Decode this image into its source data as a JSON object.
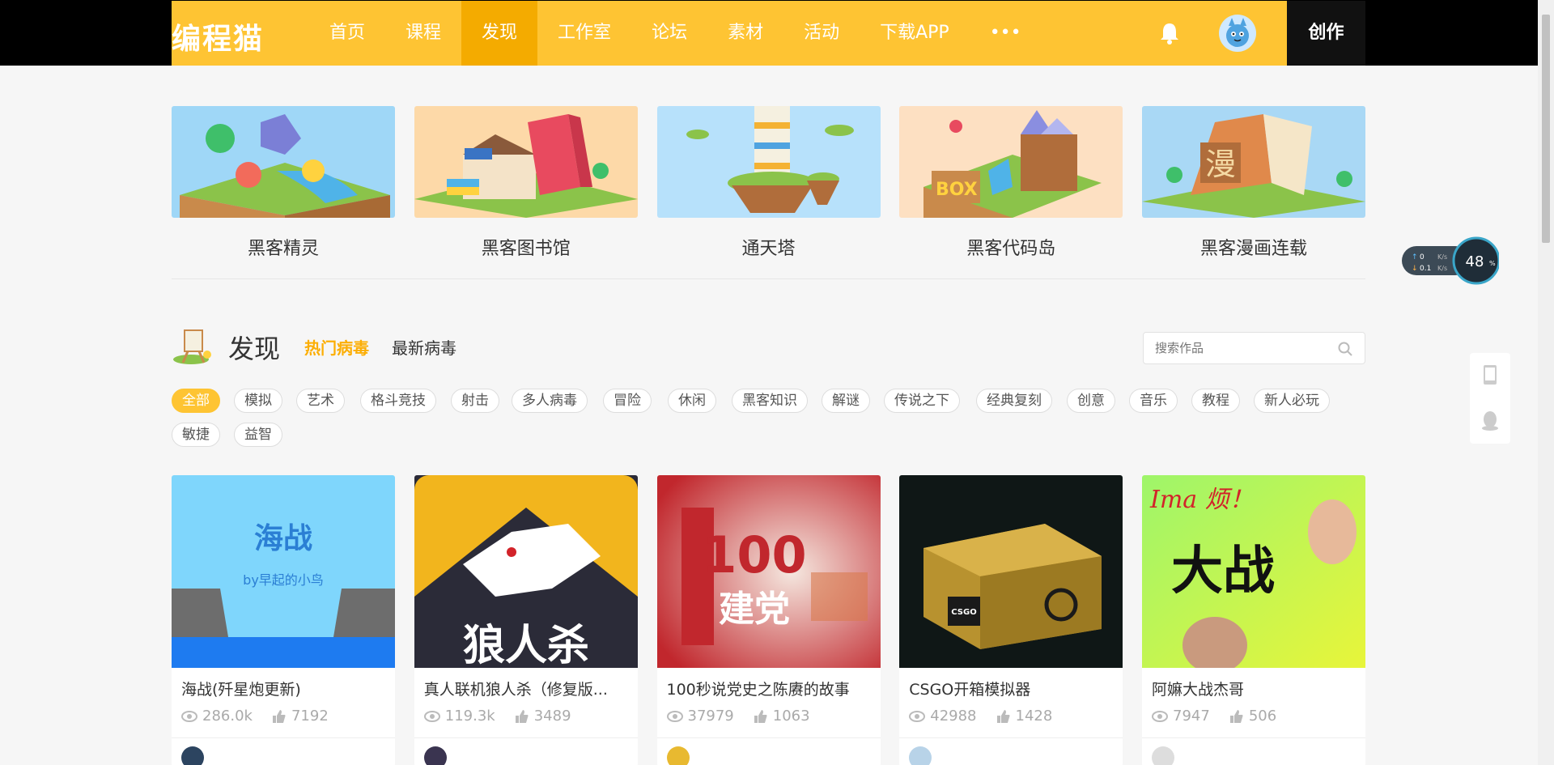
{
  "nav": {
    "logo": "编程猫",
    "items": [
      {
        "label": "首页"
      },
      {
        "label": "课程"
      },
      {
        "label": "发现",
        "active": true
      },
      {
        "label": "工作室"
      },
      {
        "label": "论坛"
      },
      {
        "label": "素材"
      },
      {
        "label": "活动"
      },
      {
        "label": "下载APP"
      },
      {
        "label": "•••"
      }
    ],
    "create_label": "创作"
  },
  "features": [
    {
      "label": "黑客精灵"
    },
    {
      "label": "黑客图书馆"
    },
    {
      "label": "通天塔"
    },
    {
      "label": "黑客代码岛"
    },
    {
      "label": "黑客漫画连载"
    }
  ],
  "discover": {
    "title": "发现",
    "tab_hot": "热门病毒",
    "tab_new": "最新病毒",
    "search_placeholder": "搜索作品"
  },
  "filters": [
    "全部",
    "模拟",
    "艺术",
    "格斗竞技",
    "射击",
    "多人病毒",
    "冒险",
    "休闲",
    "黑客知识",
    "解谜",
    "传说之下",
    "经典复刻",
    "创意",
    "音乐",
    "教程",
    "新人必玩",
    "敏捷",
    "益智"
  ],
  "cards": [
    {
      "title": "海战(歼星炮更新)",
      "views": "286.0k",
      "likes": "7192",
      "cover_text": "海战",
      "cover_sub": "by早起的小鸟"
    },
    {
      "title": "真人联机狼人杀（修复版...",
      "views": "119.3k",
      "likes": "3489",
      "cover_text": "狼人杀"
    },
    {
      "title": "100秒说党史之陈赓的故事",
      "views": "37979",
      "likes": "1063",
      "cover_text": "100",
      "cover_sub": "建党"
    },
    {
      "title": "CSGO开箱模拟器",
      "views": "42988",
      "likes": "1428",
      "cover_text": "CSGO"
    },
    {
      "title": "阿嫲大战杰哥",
      "views": "7947",
      "likes": "506",
      "cover_text": "大战",
      "cover_top": "Ima 烦！"
    }
  ],
  "speed_widget": {
    "up": "0",
    "down": "0.1",
    "unit": "K/s",
    "percent": "48"
  },
  "colors": {
    "brand_yellow": "#fec433",
    "active_tab": "#f4ab00",
    "hot_tab": "#fcae04"
  }
}
